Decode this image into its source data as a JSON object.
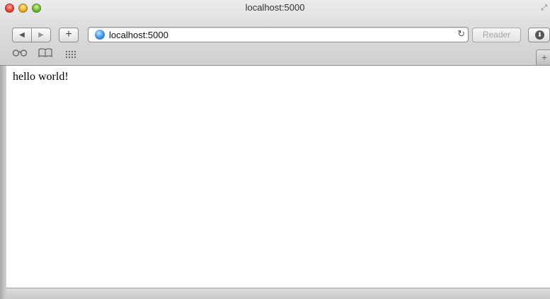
{
  "window": {
    "title": "localhost:5000"
  },
  "toolbar": {
    "back_icon": "◀",
    "forward_icon": "▶",
    "add_icon": "+",
    "address": "localhost:5000",
    "reload_icon": "↻",
    "reader_label": "Reader",
    "download_icon": "⬇"
  },
  "bookmarks_bar": {
    "reading_list_icon": "reading-glasses-icon",
    "bookmarks_icon": "book-icon",
    "top_sites_icon": "grid-icon",
    "new_tab_icon": "+"
  },
  "page": {
    "body_text": "hello world!"
  }
}
